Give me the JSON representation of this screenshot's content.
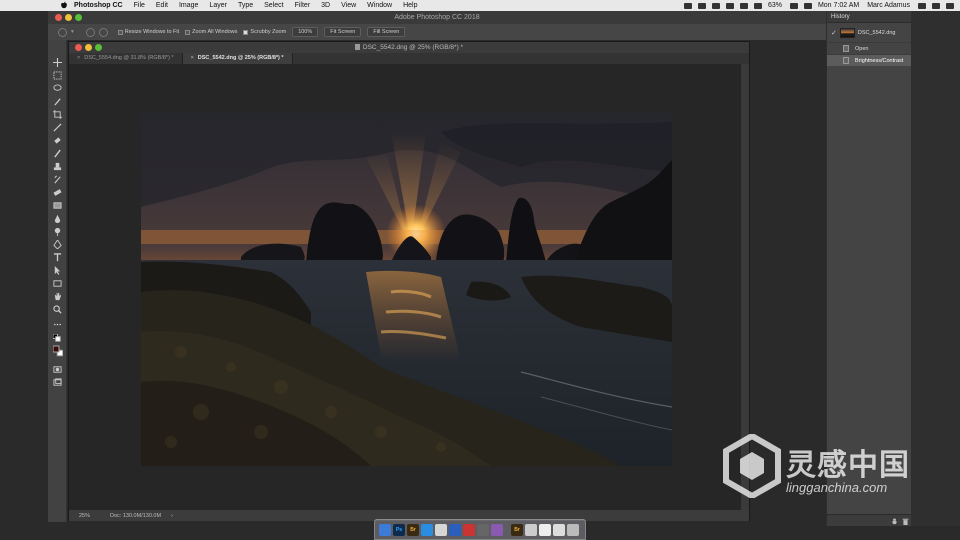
{
  "menubar": {
    "app_name": "Photoshop CC",
    "items": [
      "File",
      "Edit",
      "Image",
      "Layer",
      "Type",
      "Select",
      "Filter",
      "3D",
      "View",
      "Window",
      "Help"
    ],
    "battery": "63%",
    "clock": "Mon 7:02 AM",
    "user": "Marc Adamus"
  },
  "app": {
    "title": "Adobe Photoshop CC 2018"
  },
  "options_bar": {
    "resize_windows_label": "Resize Windows to Fit",
    "zoom_all_label": "Zoom All Windows",
    "scrubby_zoom_label": "Scrubby Zoom",
    "zoom_100_label": "100%",
    "fit_screen_label": "Fit Screen",
    "fill_screen_label": "Fill Screen",
    "resize_windows_checked": false,
    "zoom_all_checked": false,
    "scrubby_zoom_checked": true
  },
  "document": {
    "window_title": "DSC_5542.dng @ 25% (RGB/8*) *",
    "tabs": [
      {
        "label": "DSC_5554.dng @ 31.8% (RGB/8*) *",
        "active": false
      },
      {
        "label": "DSC_5542.dng @ 25% (RGB/8*) *",
        "active": true
      }
    ],
    "zoom_level": "25%",
    "doc_size": "Doc: 130.0M/130.0M"
  },
  "history": {
    "title": "History",
    "snapshot": "DSC_5542.dng",
    "states": [
      {
        "label": "Open",
        "selected": false
      },
      {
        "label": "Brightness/Contrast",
        "selected": true
      }
    ]
  },
  "watermark": {
    "title": "灵感中国",
    "url": "lingganchina.com"
  },
  "colors": {
    "panel_bg": "#444444",
    "menubar_bg": "#e8e8e8",
    "close_red": "#ec5b52",
    "min_yellow": "#f2bf3a",
    "max_green": "#57c038"
  }
}
